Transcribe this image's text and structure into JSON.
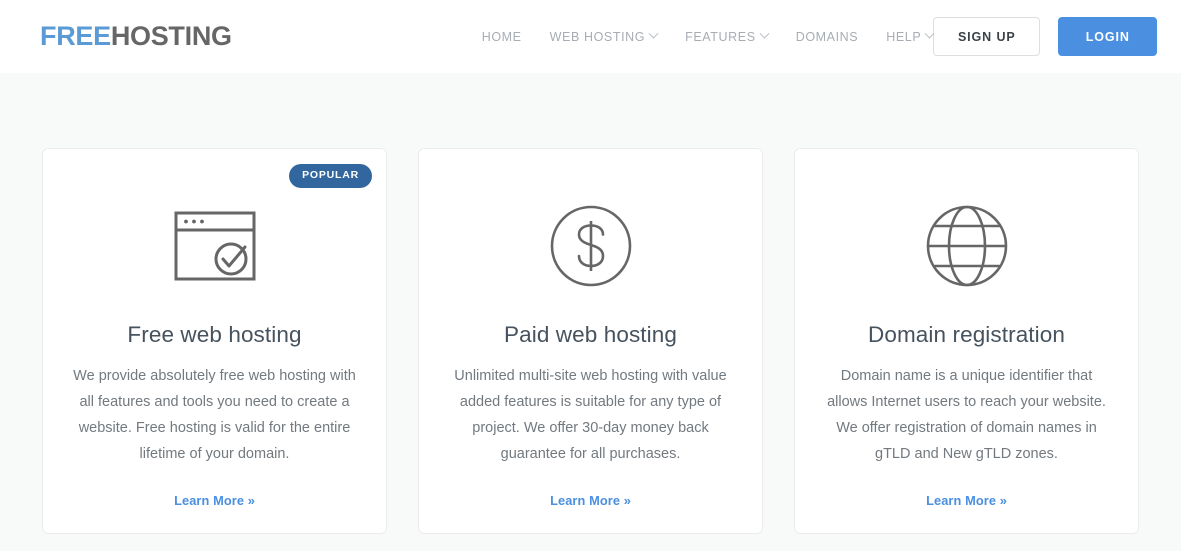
{
  "header": {
    "logo": {
      "part1": "FREE",
      "part2": "HOSTING",
      "color1": "#5b9bd5",
      "color2": "#666666"
    },
    "nav": [
      {
        "label": "HOME",
        "has_dropdown": false
      },
      {
        "label": "WEB HOSTING",
        "has_dropdown": true
      },
      {
        "label": "FEATURES",
        "has_dropdown": true
      },
      {
        "label": "DOMAINS",
        "has_dropdown": false
      },
      {
        "label": "HELP",
        "has_dropdown": true
      }
    ],
    "signup_label": "SIGN UP",
    "login_label": "LOGIN",
    "login_color": "#4a8fe0"
  },
  "cards": [
    {
      "badge": "POPULAR",
      "badge_color": "#31679e",
      "icon": "browser-window-check-icon",
      "title": "Free web hosting",
      "text": "We provide absolutely free web hosting with all features and tools you need to create a website. Free hosting is valid for the entire lifetime of your domain.",
      "link": "Learn More »"
    },
    {
      "icon": "dollar-circle-icon",
      "title": "Paid web hosting",
      "text": "Unlimited multi-site web hosting with value added features is suitable for any type of project. We offer 30-day money back guarantee for all purchases.",
      "link": "Learn More »"
    },
    {
      "icon": "globe-icon",
      "title": "Domain registration",
      "text": "Domain name is a unique identifier that allows Internet users to reach your website. We offer registration of domain names in gTLD and New gTLD zones.",
      "link": "Learn More »"
    }
  ]
}
